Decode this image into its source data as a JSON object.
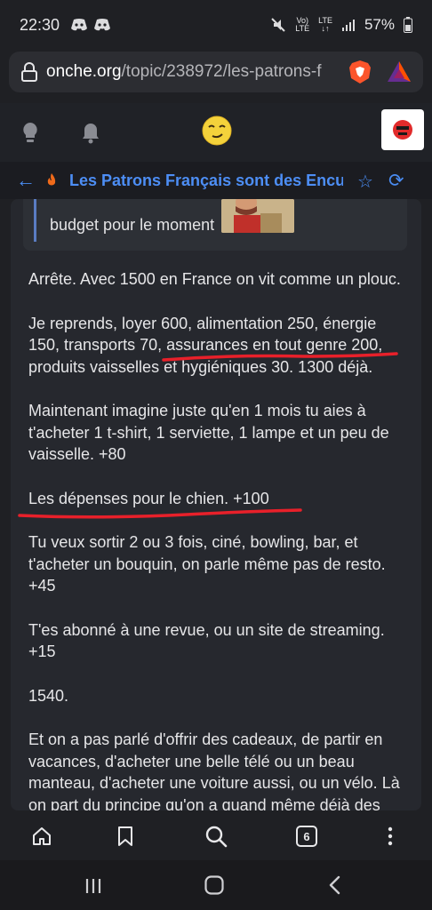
{
  "status_bar": {
    "time": "22:30",
    "network_top": "Vo)",
    "network_bottom": "LTE",
    "lte_top": "LTE",
    "battery": "57%"
  },
  "browser": {
    "url_host": "onche.org",
    "url_path": "/topic/238972/les-patrons-f",
    "tabs_count": "6"
  },
  "topic": {
    "title": "Les Patrons Français sont des Enculé",
    "accent_color": "#4d8ef5"
  },
  "quote": {
    "text": "budget pour le moment"
  },
  "post": {
    "paragraphs": [
      "Arrête. Avec 1500 en France on vit comme un plouc.",
      "Je reprends, loyer 600, alimentation 250, énergie 150, transports 70, assurances en tout genre 200, produits vaisselles et hygiéniques 30. 1300 déjà.",
      "Maintenant imagine juste qu'en 1 mois tu aies à t'acheter 1 t-shirt, 1 serviette, 1 lampe et un peu de vaisselle. +80",
      "Les dépenses pour le chien. +100",
      "Tu veux sortir 2 ou 3 fois, ciné, bowling, bar, et t'acheter un bouquin, on parle même pas de resto. +45",
      "T'es abonné à une revue, ou un site de streaming. +15",
      "1540.",
      "Et on a pas parlé d'offrir des cadeaux, de partir en vacances, d'acheter une belle télé ou un beau manteau, d'acheter une voiture aussi, ou un vélo. Là on part du principe qu'on a quand même déjà des"
    ]
  }
}
